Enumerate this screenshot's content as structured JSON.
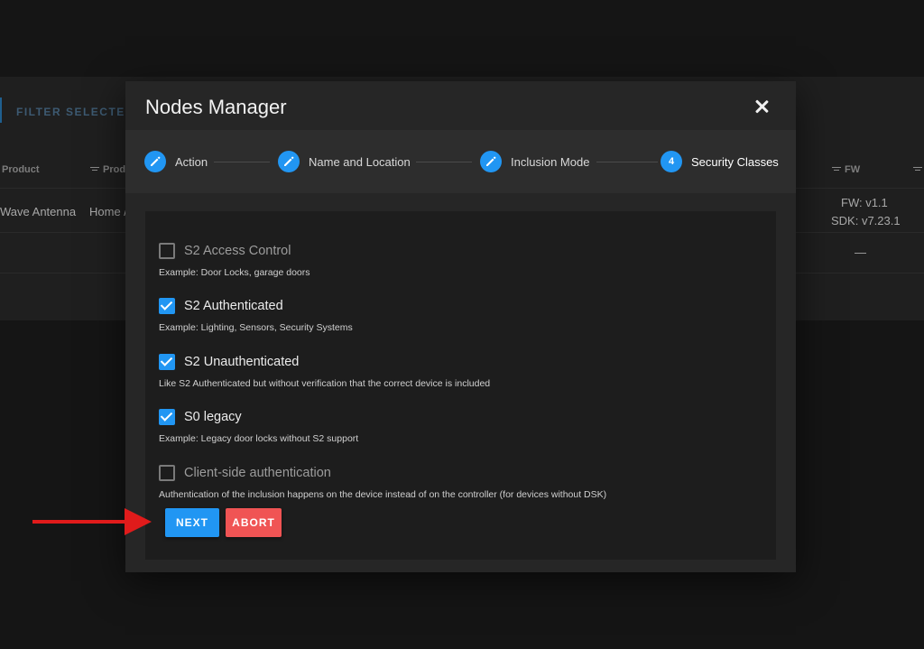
{
  "background": {
    "filter_label": "FILTER SELECTED",
    "headers": [
      "Product",
      "Prod",
      "FW"
    ],
    "row": {
      "product": "Wave Antenna",
      "location": "Home /",
      "fw_line1": "FW: v1.1",
      "fw_line2": "SDK: v7.23.1",
      "dash": "—"
    }
  },
  "dialog": {
    "title": "Nodes Manager",
    "steps": [
      {
        "label": "Action",
        "badge": "edit-icon",
        "state": "done"
      },
      {
        "label": "Name and Location",
        "badge": "edit-icon",
        "state": "done"
      },
      {
        "label": "Inclusion Mode",
        "badge": "edit-icon",
        "state": "done"
      },
      {
        "label": "Security Classes",
        "badge": "4",
        "state": "active"
      }
    ],
    "options": [
      {
        "label": "S2 Access Control",
        "description": "Example: Door Locks, garage doors",
        "checked": false
      },
      {
        "label": "S2 Authenticated",
        "description": "Example: Lighting, Sensors, Security Systems",
        "checked": true
      },
      {
        "label": "S2 Unauthenticated",
        "description": "Like S2 Authenticated but without verification that the correct device is included",
        "checked": true
      },
      {
        "label": "S0 legacy",
        "description": "Example: Legacy door locks without S2 support",
        "checked": true
      },
      {
        "label": "Client-side authentication",
        "description": "Authentication of the inclusion happens on the device instead of on the controller (for devices without DSK)",
        "checked": false
      }
    ],
    "buttons": {
      "next": "NEXT",
      "abort": "ABORT"
    }
  },
  "colors": {
    "accent": "#2196f3",
    "danger": "#f05454",
    "annotation_arrow": "#e01b1b"
  }
}
